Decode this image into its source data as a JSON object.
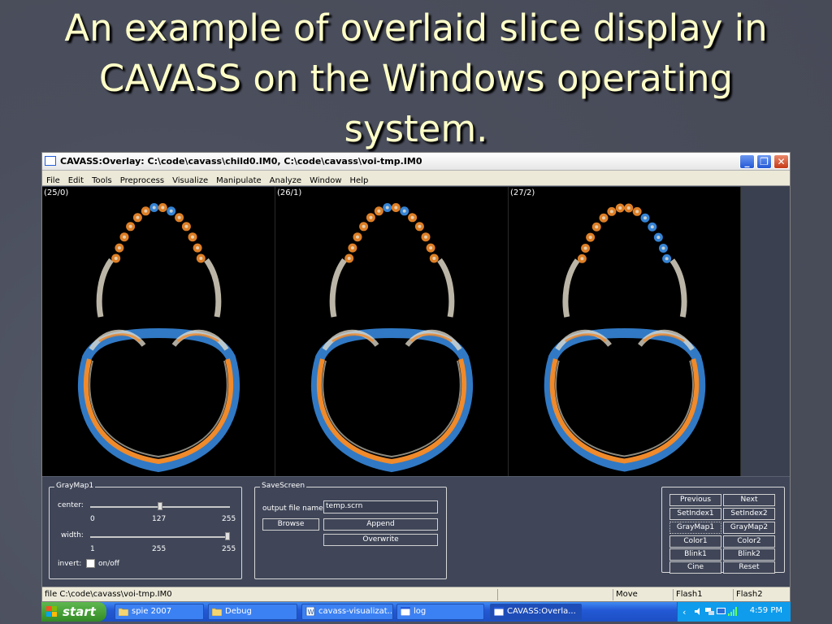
{
  "slide": {
    "title": "An example of overlaid slice display in CAVASS on the Windows operating system."
  },
  "window": {
    "title": "CAVASS:Overlay: C:\\code\\cavass\\child0.IM0, C:\\code\\cavass\\voi-tmp.IM0",
    "icon": "window-icon",
    "buttons": {
      "minimize": "minimize-icon",
      "restore": "restore-icon",
      "close": "close-icon"
    }
  },
  "menu": {
    "items": [
      "File",
      "Edit",
      "Tools",
      "Preprocess",
      "Visualize",
      "Manipulate",
      "Analyze",
      "Window",
      "Help"
    ]
  },
  "viewer": {
    "panes": [
      {
        "label": "(25/0)"
      },
      {
        "label": "(26/1)"
      },
      {
        "label": "(27/2)"
      }
    ],
    "colors": {
      "bone": "#e8e2d0",
      "orange": "#f08a2a",
      "blue": "#3a8ee6"
    }
  },
  "graymap": {
    "title": "GrayMap1",
    "center_label": "center:",
    "center_min": "0",
    "center_value": "127",
    "center_max": "255",
    "center_level": 0.5,
    "width_label": "width:",
    "width_min": "1",
    "width_value": "255",
    "width_max": "255",
    "width_level": 1.0,
    "invert_label": "invert:",
    "onoff_label": "on/off"
  },
  "savescreen": {
    "title": "SaveScreen",
    "output_label": "output file name:",
    "output_value": "temp.scrn",
    "browse": "Browse",
    "append": "Append",
    "overwrite": "Overwrite"
  },
  "nav_buttons": {
    "previous": "Previous",
    "next": "Next",
    "setindex1": "SetIndex1",
    "setindex2": "SetIndex2",
    "graymap1": "GrayMap1",
    "graymap2": "GrayMap2",
    "color1": "Color1",
    "color2": "Color2",
    "blink1": "Blink1",
    "blink2": "Blink2",
    "cine": "Cine",
    "reset": "Reset"
  },
  "status": {
    "file": "file C:\\code\\cavass\\voi-tmp.IM0",
    "mode": "Move",
    "flash1": "Flash1",
    "flash2": "Flash2"
  },
  "taskbar": {
    "start": "start",
    "items": [
      {
        "label": "spie 2007",
        "icon": "folder-icon"
      },
      {
        "label": "Debug",
        "icon": "folder-icon"
      },
      {
        "label": "cavass-visualizat...",
        "icon": "word-document-icon"
      },
      {
        "label": "log",
        "icon": "window-icon"
      },
      {
        "label": "CAVASS:Overla...",
        "icon": "window-icon"
      }
    ],
    "clock": "4:59 PM"
  }
}
